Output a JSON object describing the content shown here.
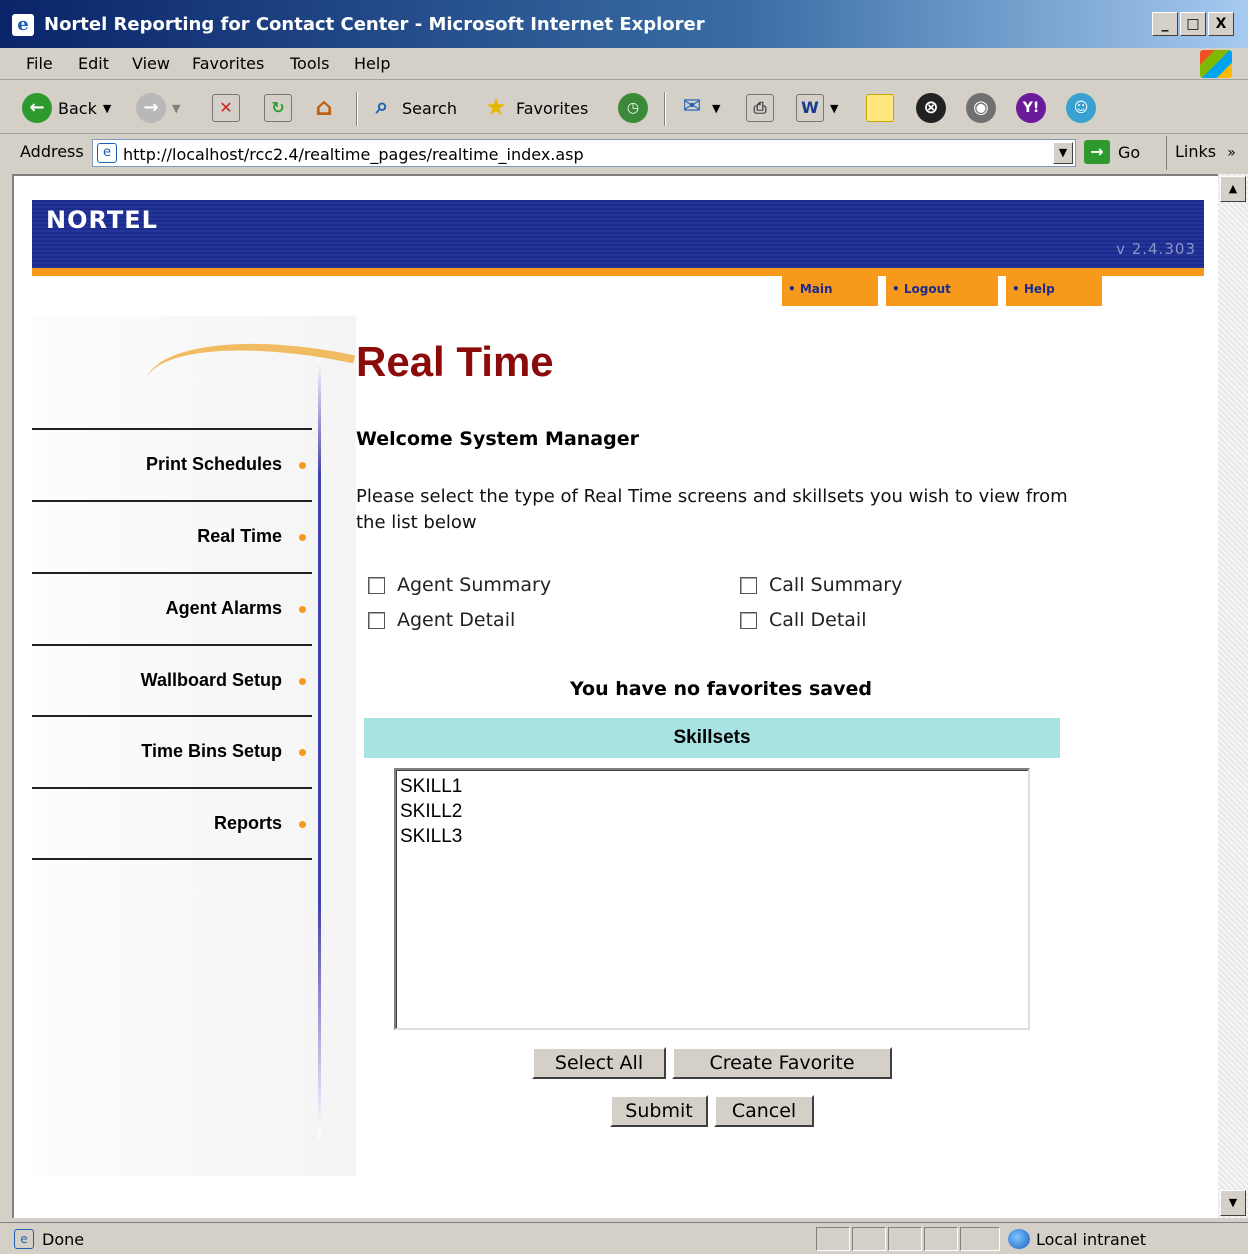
{
  "window": {
    "title": "Nortel Reporting for Contact Center - Microsoft Internet Explorer",
    "controls": [
      "_",
      "□",
      "X"
    ]
  },
  "menu": [
    "File",
    "Edit",
    "View",
    "Favorites",
    "Tools",
    "Help"
  ],
  "toolbar": {
    "back": "Back",
    "search": "Search",
    "favorites": "Favorites"
  },
  "address": {
    "label": "Address",
    "url": "http://localhost/rcc2.4/realtime_pages/realtime_index.asp",
    "go": "Go",
    "links": "Links"
  },
  "banner": {
    "logo": "NORTEL",
    "version": "v 2.4.303"
  },
  "topnav": [
    "• Main",
    "• Logout",
    "• Help"
  ],
  "sidebar": {
    "items": [
      "Print Schedules",
      "Real Time",
      "Agent Alarms",
      "Wallboard Setup",
      "Time Bins Setup",
      "Reports"
    ]
  },
  "main": {
    "heading": "Real Time",
    "welcome": "Welcome System Manager",
    "instructions": "Please select the type of Real Time screens and skillsets you wish to view from the list below",
    "checkboxes": [
      "Agent Summary",
      "Call Summary",
      "Agent Detail",
      "Call Detail"
    ],
    "favorites_message": "You have no favorites saved",
    "skillsets_header": "Skillsets",
    "skillsets": [
      "SKILL1",
      "SKILL2",
      "SKILL3"
    ],
    "buttons": {
      "select_all": "Select All",
      "create_favorite": "Create Favorite",
      "submit": "Submit",
      "cancel": "Cancel"
    }
  },
  "status": {
    "text": "Done",
    "zone": "Local intranet"
  },
  "colors": {
    "banner": "#1c2b8c",
    "accent_orange": "#f79a1c",
    "heading_red": "#8b0a0a",
    "skillsets_header": "#a8e2e2"
  }
}
